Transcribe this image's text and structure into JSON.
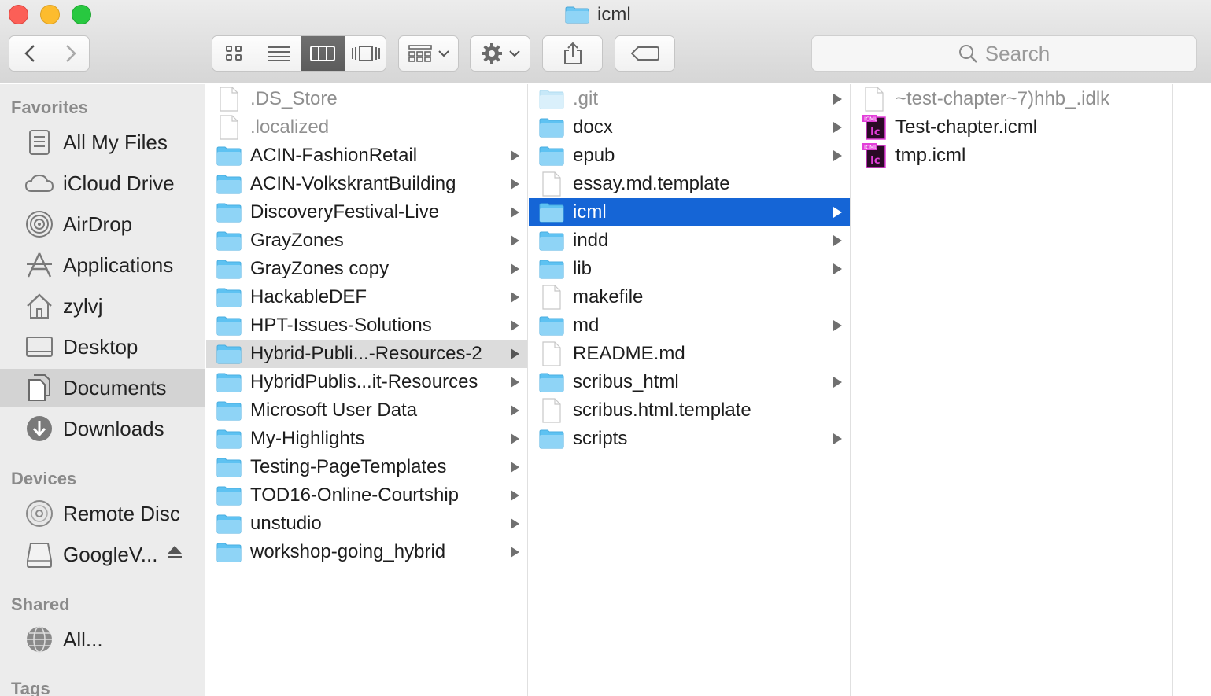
{
  "window": {
    "title": "icml"
  },
  "toolbar": {
    "search_placeholder": "Search",
    "view_modes": [
      "icon-view",
      "list-view",
      "column-view",
      "cover-flow-view"
    ],
    "active_view": "column-view"
  },
  "sidebar": {
    "sections": [
      {
        "title": "Favorites",
        "items": [
          {
            "label": "All My Files",
            "icon": "all-files-icon"
          },
          {
            "label": "iCloud Drive",
            "icon": "cloud-icon"
          },
          {
            "label": "AirDrop",
            "icon": "airdrop-icon"
          },
          {
            "label": "Applications",
            "icon": "applications-icon"
          },
          {
            "label": "zylvj",
            "icon": "home-icon"
          },
          {
            "label": "Desktop",
            "icon": "desktop-icon"
          },
          {
            "label": "Documents",
            "icon": "documents-icon",
            "selected": true
          },
          {
            "label": "Downloads",
            "icon": "downloads-icon"
          }
        ]
      },
      {
        "title": "Devices",
        "items": [
          {
            "label": "Remote Disc",
            "icon": "disc-icon"
          },
          {
            "label": "GoogleV...",
            "icon": "drive-icon",
            "eject": true
          }
        ]
      },
      {
        "title": "Shared",
        "items": [
          {
            "label": "All...",
            "icon": "network-icon"
          }
        ]
      },
      {
        "title": "Tags",
        "items": []
      }
    ]
  },
  "columns": [
    {
      "name": "documents-column",
      "items": [
        {
          "label": ".DS_Store",
          "type": "file",
          "dim": true
        },
        {
          "label": ".localized",
          "type": "file",
          "dim": true
        },
        {
          "label": "ACIN-FashionRetail",
          "type": "folder"
        },
        {
          "label": "ACIN-VolkskrantBuilding",
          "type": "folder"
        },
        {
          "label": "DiscoveryFestival-Live",
          "type": "folder"
        },
        {
          "label": "GrayZones",
          "type": "folder"
        },
        {
          "label": "GrayZones copy",
          "type": "folder"
        },
        {
          "label": "HackableDEF",
          "type": "folder"
        },
        {
          "label": "HPT-Issues-Solutions",
          "type": "folder"
        },
        {
          "label": "Hybrid-Publi...-Resources-2",
          "type": "folder",
          "selected": "gray"
        },
        {
          "label": "HybridPublis...it-Resources",
          "type": "folder"
        },
        {
          "label": "Microsoft User Data",
          "type": "folder"
        },
        {
          "label": "My-Highlights",
          "type": "folder"
        },
        {
          "label": "Testing-PageTemplates",
          "type": "folder"
        },
        {
          "label": "TOD16-Online-Courtship",
          "type": "folder"
        },
        {
          "label": "unstudio",
          "type": "folder"
        },
        {
          "label": "workshop-going_hybrid",
          "type": "folder"
        }
      ]
    },
    {
      "name": "resources-column",
      "items": [
        {
          "label": ".git",
          "type": "folder",
          "dim": true
        },
        {
          "label": "docx",
          "type": "folder"
        },
        {
          "label": "epub",
          "type": "folder"
        },
        {
          "label": "essay.md.template",
          "type": "file"
        },
        {
          "label": "icml",
          "type": "folder",
          "selected": "blue"
        },
        {
          "label": "indd",
          "type": "folder"
        },
        {
          "label": "lib",
          "type": "folder"
        },
        {
          "label": "makefile",
          "type": "file"
        },
        {
          "label": "md",
          "type": "folder"
        },
        {
          "label": "README.md",
          "type": "file"
        },
        {
          "label": "scribus_html",
          "type": "folder"
        },
        {
          "label": "scribus.html.template",
          "type": "file"
        },
        {
          "label": "scripts",
          "type": "folder"
        }
      ]
    },
    {
      "name": "icml-column",
      "items": [
        {
          "label": "~test-chapter~7)hhb_.idlk",
          "type": "file",
          "dim": true
        },
        {
          "label": "Test-chapter.icml",
          "type": "icml",
          "badge": "ICML",
          "letters": "Ic"
        },
        {
          "label": "tmp.icml",
          "type": "icml",
          "badge": "ICML",
          "letters": "Ic"
        }
      ]
    }
  ],
  "colors": {
    "selection_blue": "#1565d6",
    "folder_blue": "#5ec2f2",
    "icml_magenta": "#e23fd9",
    "icml_dark": "#2a0a26"
  }
}
